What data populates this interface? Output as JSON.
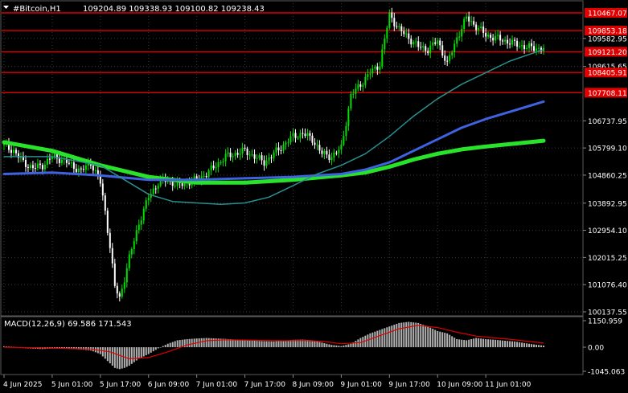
{
  "header": {
    "symbol": "#Bitcoin,H1",
    "ohlc": "109204.89 109338.93 109100.82 109238.43"
  },
  "colors": {
    "background": "#000000",
    "candle_bull": "#00e000",
    "candle_bear": "#ffffff",
    "ma_fast": "#2a8f8f",
    "ma_mid": "#3f63e0",
    "ma_slow": "#29e32b",
    "level_line": "#e00000",
    "macd_hist": "#b4b4b4",
    "macd_signal": "#e00000",
    "grid": "#3a3a3a",
    "text": "#ffffff"
  },
  "chart_data": {
    "type": "line",
    "price_axis": {
      "ylim": [
        100137.55,
        110800
      ],
      "ticks": [
        {
          "value": 109582.95,
          "label": "109582.95"
        },
        {
          "value": 108615.65,
          "label": "108615.65"
        },
        {
          "value": 106737.95,
          "label": "106737.95"
        },
        {
          "value": 105799.1,
          "label": "105799.10"
        },
        {
          "value": 104860.25,
          "label": "104860.25"
        },
        {
          "value": 103892.95,
          "label": "103892.95"
        },
        {
          "value": 102954.1,
          "label": "102954.10"
        },
        {
          "value": 102015.25,
          "label": "102015.25"
        },
        {
          "value": 101076.4,
          "label": "101076.40"
        },
        {
          "value": 100137.55,
          "label": "100137.55"
        }
      ]
    },
    "levels": [
      {
        "value": 110467.07,
        "label": "110467.07"
      },
      {
        "value": 109853.18,
        "label": "109853.18"
      },
      {
        "value": 109121.2,
        "label": "109121.20"
      },
      {
        "value": 108405.91,
        "label": "108405.91"
      },
      {
        "value": 107708.11,
        "label": "107708.11"
      }
    ],
    "x_axis": {
      "range": [
        0,
        116
      ],
      "ticks": [
        {
          "x": 0,
          "label": "4 Jun 2025"
        },
        {
          "x": 10,
          "label": "5 Jun 01:00"
        },
        {
          "x": 20,
          "label": "5 Jun 17:00"
        },
        {
          "x": 30,
          "label": "6 Jun 09:00"
        },
        {
          "x": 40,
          "label": "7 Jun 01:00"
        },
        {
          "x": 50,
          "label": "7 Jun 17:00"
        },
        {
          "x": 60,
          "label": "8 Jun 09:00"
        },
        {
          "x": 70,
          "label": "9 Jun 01:00"
        },
        {
          "x": 80,
          "label": "9 Jun 17:00"
        },
        {
          "x": 90,
          "label": "10 Jun 09:00"
        },
        {
          "x": 100,
          "label": "11 Jun 01:00"
        }
      ]
    },
    "price_series": {
      "x": [
        0,
        2,
        4,
        6,
        8,
        10,
        12,
        14,
        16,
        18,
        20,
        21,
        22,
        23,
        24,
        25,
        26,
        28,
        30,
        32,
        34,
        36,
        38,
        40,
        42,
        44,
        46,
        48,
        50,
        52,
        54,
        56,
        58,
        60,
        62,
        64,
        66,
        68,
        70,
        72,
        74,
        76,
        78,
        80,
        82,
        84,
        86,
        88,
        90,
        92,
        94,
        96,
        98,
        100,
        102,
        104,
        106,
        108,
        110,
        112
      ],
      "values": [
        105900,
        105700,
        105300,
        105100,
        105200,
        105500,
        105400,
        105200,
        105000,
        105300,
        104600,
        103600,
        102400,
        101000,
        100600,
        101300,
        102000,
        103200,
        104100,
        104600,
        104700,
        104500,
        104600,
        104700,
        104900,
        105200,
        105500,
        105600,
        105700,
        105500,
        105300,
        105600,
        105900,
        106200,
        106300,
        106100,
        105600,
        105500,
        105800,
        107600,
        108000,
        108400,
        108700,
        110400,
        109900,
        109600,
        109300,
        109200,
        109500,
        108700,
        109600,
        110300,
        110000,
        109700,
        109600,
        109500,
        109400,
        109300,
        109250,
        109238
      ]
    },
    "ma_fast": {
      "x": [
        0,
        10,
        20,
        30,
        35,
        40,
        45,
        50,
        55,
        60,
        65,
        70,
        75,
        80,
        85,
        90,
        95,
        100,
        105,
        112
      ],
      "values": [
        105500,
        105500,
        105200,
        104200,
        103950,
        103900,
        103850,
        103900,
        104100,
        104500,
        104900,
        105200,
        105600,
        106200,
        106900,
        107500,
        108000,
        108400,
        108800,
        109200
      ]
    },
    "ma_mid": {
      "x": [
        0,
        10,
        20,
        30,
        40,
        50,
        60,
        70,
        75,
        80,
        85,
        90,
        95,
        100,
        106,
        112
      ],
      "values": [
        104900,
        104950,
        104850,
        104700,
        104700,
        104750,
        104800,
        104900,
        105050,
        105300,
        105700,
        106100,
        106500,
        106800,
        107100,
        107400
      ]
    },
    "ma_slow": {
      "x": [
        0,
        10,
        20,
        30,
        40,
        50,
        60,
        70,
        75,
        80,
        85,
        90,
        95,
        100,
        106,
        112
      ],
      "values": [
        106000,
        105700,
        105200,
        104800,
        104600,
        104600,
        104700,
        104850,
        104950,
        105150,
        105400,
        105600,
        105750,
        105850,
        105950,
        106050
      ]
    },
    "macd": {
      "label": "MACD(12,26,9) 69.586 171.543",
      "ylim": [
        -1045.063,
        1150.959
      ],
      "ticks": [
        {
          "value": 1150.959,
          "label": "1150.959"
        },
        {
          "value": 0.0,
          "label": "0.00"
        },
        {
          "value": -1045.063,
          "label": "-1045.063"
        }
      ],
      "hist_x": [
        0,
        2,
        4,
        6,
        8,
        10,
        12,
        14,
        16,
        18,
        20,
        22,
        23,
        24,
        25,
        26,
        28,
        30,
        32,
        34,
        36,
        38,
        40,
        42,
        44,
        46,
        48,
        50,
        52,
        54,
        56,
        58,
        60,
        62,
        64,
        66,
        68,
        70,
        72,
        74,
        76,
        78,
        80,
        82,
        84,
        86,
        88,
        90,
        92,
        94,
        96,
        98,
        100,
        102,
        104,
        106,
        108,
        110,
        112
      ],
      "hist_values": [
        40,
        20,
        -40,
        -60,
        -80,
        -60,
        -60,
        -80,
        -100,
        -140,
        -300,
        -700,
        -900,
        -950,
        -900,
        -800,
        -500,
        -300,
        -50,
        150,
        300,
        350,
        380,
        400,
        380,
        360,
        330,
        300,
        280,
        260,
        250,
        280,
        320,
        330,
        300,
        200,
        100,
        50,
        150,
        400,
        600,
        750,
        900,
        1050,
        1100,
        1050,
        900,
        700,
        600,
        350,
        300,
        400,
        350,
        320,
        280,
        250,
        180,
        120,
        70
      ],
      "signal_x": [
        0,
        6,
        12,
        18,
        22,
        26,
        30,
        34,
        38,
        42,
        46,
        50,
        54,
        58,
        62,
        66,
        70,
        74,
        78,
        82,
        86,
        90,
        94,
        98,
        102,
        106,
        112
      ],
      "signal_values": [
        0,
        -20,
        -50,
        -80,
        -200,
        -500,
        -450,
        -200,
        100,
        280,
        320,
        310,
        290,
        280,
        290,
        260,
        150,
        200,
        500,
        800,
        950,
        850,
        650,
        480,
        400,
        320,
        180
      ]
    }
  }
}
